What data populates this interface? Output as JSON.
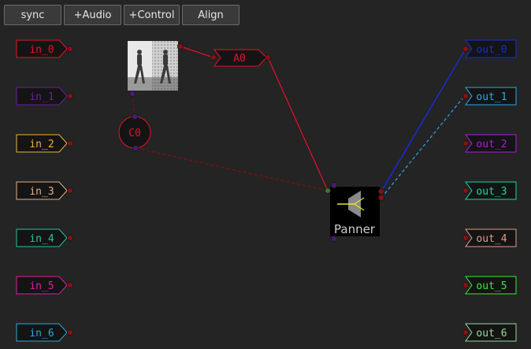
{
  "toolbar": {
    "buttons": [
      {
        "label": "sync",
        "name": "sync-button"
      },
      {
        "label": "+Audio",
        "name": "add-audio-button"
      },
      {
        "label": "+Control",
        "name": "add-control-button"
      },
      {
        "label": "Align",
        "name": "align-button"
      }
    ]
  },
  "inputs": [
    {
      "label": "in_0",
      "color": "#e8102a"
    },
    {
      "label": "in_1",
      "color": "#6a1fa0"
    },
    {
      "label": "in_2",
      "color": "#f0b23a"
    },
    {
      "label": "in_3",
      "color": "#e0b08a"
    },
    {
      "label": "in_4",
      "color": "#1fc5a0"
    },
    {
      "label": "in_5",
      "color": "#e01aa5"
    },
    {
      "label": "in_6",
      "color": "#2aa8d8"
    }
  ],
  "outputs": [
    {
      "label": "out_0",
      "color": "#1a2ad8"
    },
    {
      "label": "out_1",
      "color": "#2aa8e8"
    },
    {
      "label": "out_2",
      "color": "#b01ad8"
    },
    {
      "label": "out_3",
      "color": "#1ad8a0"
    },
    {
      "label": "out_4",
      "color": "#e09a8a"
    },
    {
      "label": "out_5",
      "color": "#3ae83a"
    },
    {
      "label": "out_6",
      "color": "#9ad89a"
    }
  ],
  "nodes": {
    "video": {
      "name": "video-thumbnail"
    },
    "audio_clip": {
      "label": "A0",
      "color": "#e8102a"
    },
    "control": {
      "label": "C0",
      "color": "#e8102a"
    },
    "panner": {
      "label": "Panner"
    }
  },
  "colors": {
    "background": "#242424",
    "port": "#8a1010",
    "port_purple": "#4a1a7a",
    "port_green": "#3a7a2a",
    "wire_red": "#e8102a",
    "wire_dark_red": "#7a1010",
    "wire_blue": "#1a2ad8",
    "wire_light_blue": "#2aa8e8"
  }
}
